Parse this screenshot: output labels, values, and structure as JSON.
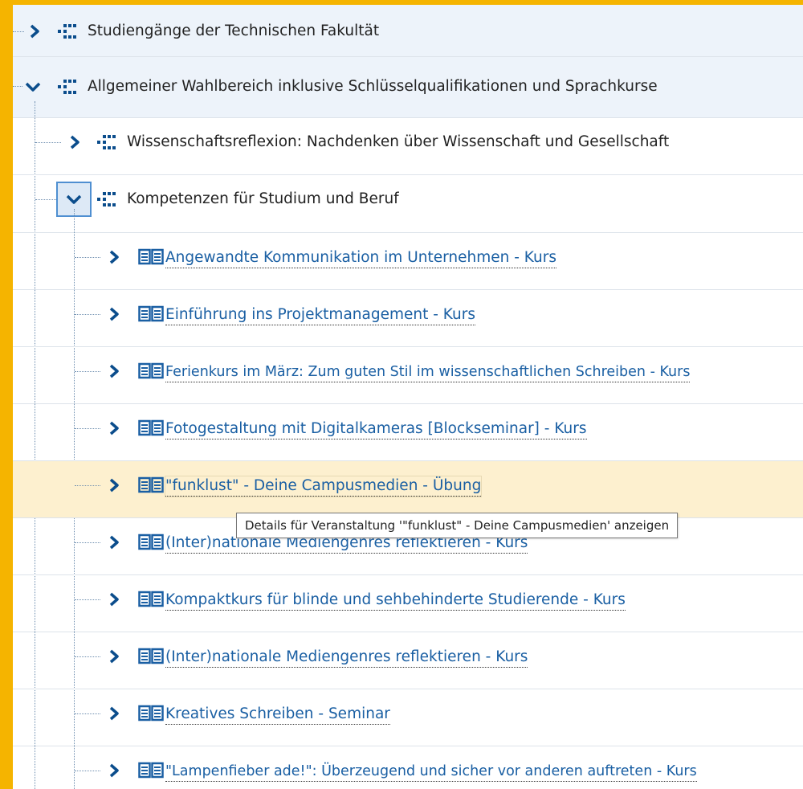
{
  "tree": {
    "top_groups": [
      {
        "label": "Studiengänge der Technischen Fakultät",
        "expanded": false
      },
      {
        "label": "Allgemeiner Wahlbereich inklusive Schlüsselqualifikationen und Sprachkurse",
        "expanded": true
      }
    ],
    "subgroups": [
      {
        "label": "Wissenschaftsreflexion: Nachdenken über Wissenschaft und Gesellschaft",
        "expanded": false
      },
      {
        "label": "Kompetenzen für Studium und Beruf",
        "expanded": true
      }
    ],
    "courses": [
      {
        "label": "Angewandte Kommunikation im Unternehmen - Kurs"
      },
      {
        "label": "Einführung ins Projektmanagement - Kurs"
      },
      {
        "label": "Ferienkurs im März: Zum guten Stil im wissenschaftlichen Schreiben - Kurs"
      },
      {
        "label": "Fotogestaltung mit Digitalkameras [Blockseminar] - Kurs"
      },
      {
        "label": "\"funklust\" - Deine Campusmedien - Übung"
      },
      {
        "label": "(Inter)nationale Mediengenres reflektieren - Kurs"
      },
      {
        "label": "Kompaktkurs für blinde und sehbehinderte Studierende - Kurs"
      },
      {
        "label": "(Inter)nationale Mediengenres reflektieren - Kurs"
      },
      {
        "label": "Kreatives Schreiben - Seminar"
      },
      {
        "label": "\"Lampenfieber ade!\": Überzeugend und sicher vor anderen auftreten - Kurs"
      }
    ]
  },
  "tooltip": {
    "text": "Details für Veranstaltung '\"funklust\" - Deine Campusmedien' anzeigen"
  },
  "colors": {
    "frame": "#f5b400",
    "link": "#1a5fa3",
    "hover_row": "#fdf0cf",
    "group_row": "#edf3fa",
    "accent": "#0b4d8c"
  },
  "icons": {
    "group": "tree-dots-icon",
    "course": "open-book-icon",
    "collapsed": "chevron-right-icon",
    "expanded": "chevron-down-icon"
  }
}
